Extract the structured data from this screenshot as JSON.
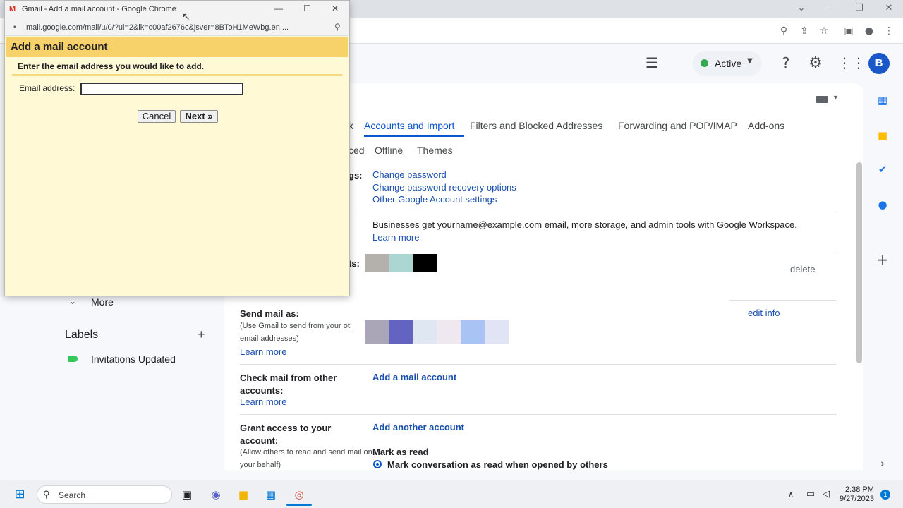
{
  "browser": {
    "minimize_glyph": "—",
    "restore_glyph": "❐",
    "close_glyph": "✕",
    "chevron_glyph": "⌄"
  },
  "gmail": {
    "status_label": "Active",
    "avatar_letter": "B",
    "nav": {
      "more_label": "More",
      "labels_heading": "Labels",
      "label_item": "Invitations Updated",
      "label_color": "#34c759"
    },
    "tabs": {
      "row1_fragment": "k",
      "accounts_import": "Accounts and Import",
      "filters": "Filters and Blocked Addresses",
      "forwarding": "Forwarding and POP/IMAP",
      "addons": "Add-ons",
      "row2_fragment": "ced",
      "offline": "Offline",
      "themes": "Themes"
    },
    "settings": {
      "change_settings_fragment": "gs:",
      "change_password": "Change password",
      "change_recovery": "Change password recovery options",
      "other_google_settings": "Other Google Account settings",
      "workspace_text": "Businesses get yourname@example.com email, more storage, and admin tools with Google Workspace.",
      "learn_more": "Learn more",
      "accounts_fragment": "ts:",
      "delete": "delete",
      "send_mail_as": "Send mail as:",
      "send_mail_sub": "(Use Gmail to send from your ot! email addresses)",
      "edit_info": "edit info",
      "check_mail": "Check mail from other accounts:",
      "add_mail_account": "Add a mail account",
      "grant_access": "Grant access to your account:",
      "grant_sub": "(Allow others to read and send mail on your behalf)",
      "add_another_account": "Add another account",
      "mark_as_read": "Mark as read",
      "mark_conversation": "Mark conversation as read when opened by others"
    },
    "accent_color": "#0b57d0"
  },
  "popup": {
    "window_title": "Gmail - Add a mail account - Google Chrome",
    "url": "mail.google.com/mail/u/0/?ui=2&ik=c00af2676c&jsver=8BToH1MeWbg.en....",
    "heading": "Add a mail account",
    "instruction": "Enter the email address you would like to add.",
    "email_label": "Email address:",
    "email_value": "",
    "cancel": "Cancel",
    "next": "Next »",
    "header_color": "#f7d26a",
    "body_color": "#fff9d6"
  },
  "taskbar": {
    "search_placeholder": "Search",
    "time": "2:38 PM",
    "date": "9/27/2023",
    "notification_count": "1"
  }
}
